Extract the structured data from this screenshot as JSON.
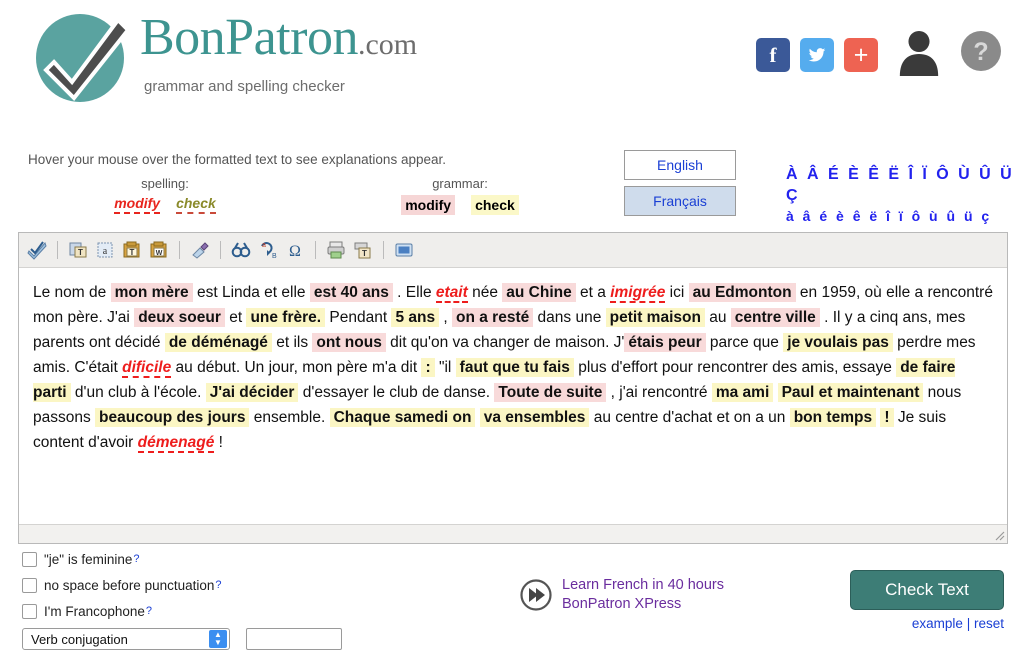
{
  "header": {
    "brand_main": "BonPatron",
    "brand_dotcom": ".com",
    "tagline": "grammar and spelling checker",
    "social": [
      {
        "name": "facebook-button",
        "glyph": "f",
        "color": "#3b5998"
      },
      {
        "name": "twitter-button",
        "glyph": "bird",
        "color": "#55acee"
      },
      {
        "name": "share-button",
        "glyph": "+",
        "color": "#ee6352"
      }
    ],
    "account_icon": "user-icon",
    "help_icon": "help-icon"
  },
  "instructions": {
    "hint": "Hover your mouse over the formatted text to see explanations appear.",
    "spelling_title": "spelling:",
    "spelling_modify": "modify",
    "spelling_check": "check",
    "grammar_title": "grammar:",
    "grammar_modify": "modify",
    "grammar_check": "check"
  },
  "language": {
    "english": "English",
    "francais": "Français",
    "selected": "Français",
    "accents_upper": "À Â É È Ê Ë Î Ï Ô Ù Û Ü Ç",
    "accents_lower": "à â é è ê ë î ï ô ù û ü ç"
  },
  "toolbar": {
    "items": [
      {
        "name": "spellcheck-icon"
      },
      {
        "name": "paste-text-icon"
      },
      {
        "name": "paste-plain-icon"
      },
      {
        "name": "paste-formatted-icon"
      },
      {
        "name": "paste-word-icon"
      },
      {
        "name": "clear-format-icon"
      },
      {
        "name": "find-icon"
      },
      {
        "name": "replace-icon"
      },
      {
        "name": "special-character-icon"
      },
      {
        "name": "print-icon"
      },
      {
        "name": "print-preview-icon"
      },
      {
        "name": "maximize-icon"
      }
    ]
  },
  "editor": {
    "tokens": [
      {
        "t": "Le nom de ",
        "s": "plain"
      },
      {
        "t": "mon mère",
        "s": "pink"
      },
      {
        "t": " est Linda et elle ",
        "s": "plain"
      },
      {
        "t": "est 40 ans",
        "s": "pink"
      },
      {
        "t": " . Elle ",
        "s": "plain"
      },
      {
        "t": "etait",
        "s": "spell"
      },
      {
        "t": " née ",
        "s": "plain"
      },
      {
        "t": "au Chine",
        "s": "pink"
      },
      {
        "t": " et a ",
        "s": "plain"
      },
      {
        "t": "imigrée",
        "s": "spell"
      },
      {
        "t": " ici ",
        "s": "plain"
      },
      {
        "t": "au Edmonton",
        "s": "pink"
      },
      {
        "t": " en 1959, où elle a rencontré mon père. J'ai ",
        "s": "plain"
      },
      {
        "t": "deux soeur",
        "s": "pink"
      },
      {
        "t": " et ",
        "s": "plain"
      },
      {
        "t": "une frère.",
        "s": "yellow"
      },
      {
        "t": " Pendant ",
        "s": "plain"
      },
      {
        "t": "5 ans",
        "s": "yellow"
      },
      {
        "t": " , ",
        "s": "plain"
      },
      {
        "t": "on a resté",
        "s": "pink"
      },
      {
        "t": " dans une ",
        "s": "plain"
      },
      {
        "t": "petit maison",
        "s": "yellow"
      },
      {
        "t": " au ",
        "s": "plain"
      },
      {
        "t": "centre ville",
        "s": "pink"
      },
      {
        "t": " . Il y a cinq ans, mes parents ont décidé ",
        "s": "plain"
      },
      {
        "t": "de déménagé",
        "s": "yellow"
      },
      {
        "t": " et ils ",
        "s": "plain"
      },
      {
        "t": "ont nous",
        "s": "pink"
      },
      {
        "t": " dit qu'on va changer de maison. J'",
        "s": "plain"
      },
      {
        "t": "étais peur",
        "s": "pink"
      },
      {
        "t": " parce que ",
        "s": "plain"
      },
      {
        "t": "je voulais pas",
        "s": "yellow"
      },
      {
        "t": " perdre mes amis. C'était ",
        "s": "plain"
      },
      {
        "t": "dificile",
        "s": "spell"
      },
      {
        "t": " au début. Un jour, mon père m'a dit ",
        "s": "plain"
      },
      {
        "t": ":",
        "s": "yellow"
      },
      {
        "t": " \"il ",
        "s": "plain"
      },
      {
        "t": "faut que tu fais",
        "s": "yellow"
      },
      {
        "t": " plus d'effort pour rencontrer des amis, essaye ",
        "s": "plain"
      },
      {
        "t": "de faire parti",
        "s": "yellow"
      },
      {
        "t": " d'un club à l'école. ",
        "s": "plain"
      },
      {
        "t": "J'ai décider",
        "s": "yellow"
      },
      {
        "t": " d'essayer le club de danse. ",
        "s": "plain"
      },
      {
        "t": "Toute de suite",
        "s": "pink"
      },
      {
        "t": " , j'ai rencontré ",
        "s": "plain"
      },
      {
        "t": "ma ami",
        "s": "yellow"
      },
      {
        "t": " ",
        "s": "plain"
      },
      {
        "t": "Paul et maintenant",
        "s": "yellow"
      },
      {
        "t": " nous passons ",
        "s": "plain"
      },
      {
        "t": "beaucoup des jours",
        "s": "yellow"
      },
      {
        "t": " ensemble. ",
        "s": "plain"
      },
      {
        "t": "Chaque samedi on",
        "s": "yellow"
      },
      {
        "t": " ",
        "s": "plain"
      },
      {
        "t": "va ensembles",
        "s": "yellow"
      },
      {
        "t": " au centre d'achat et on a un ",
        "s": "plain"
      },
      {
        "t": "bon temps",
        "s": "yellow"
      },
      {
        "t": " ",
        "s": "plain"
      },
      {
        "t": "!",
        "s": "yellow"
      },
      {
        "t": " Je suis content d'avoir ",
        "s": "plain"
      },
      {
        "t": "démenagé",
        "s": "spell"
      },
      {
        "t": " !",
        "s": "plain"
      }
    ]
  },
  "options": {
    "je_feminine": "\"je\" is feminine",
    "no_space": "no space before punctuation",
    "francophone": "I'm Francophone",
    "help_marker": "?",
    "dropdown_value": "Verb conjugation",
    "text_input_value": ""
  },
  "promo": {
    "line1": "Learn French in 40 hours",
    "line2": "BonPatron XPress"
  },
  "actions": {
    "check_text": "Check Text",
    "example": "example",
    "separator": "|",
    "reset": "reset"
  },
  "colors": {
    "brand_teal": "#3d9490",
    "grammar_modify_bg": "#f8dada",
    "grammar_check_bg": "#fbf6c4",
    "spelling_red": "#ee1d1d",
    "link_blue": "#1a3fd4",
    "promo_purple": "#6a2d9e",
    "button_green": "#3d7d76"
  }
}
